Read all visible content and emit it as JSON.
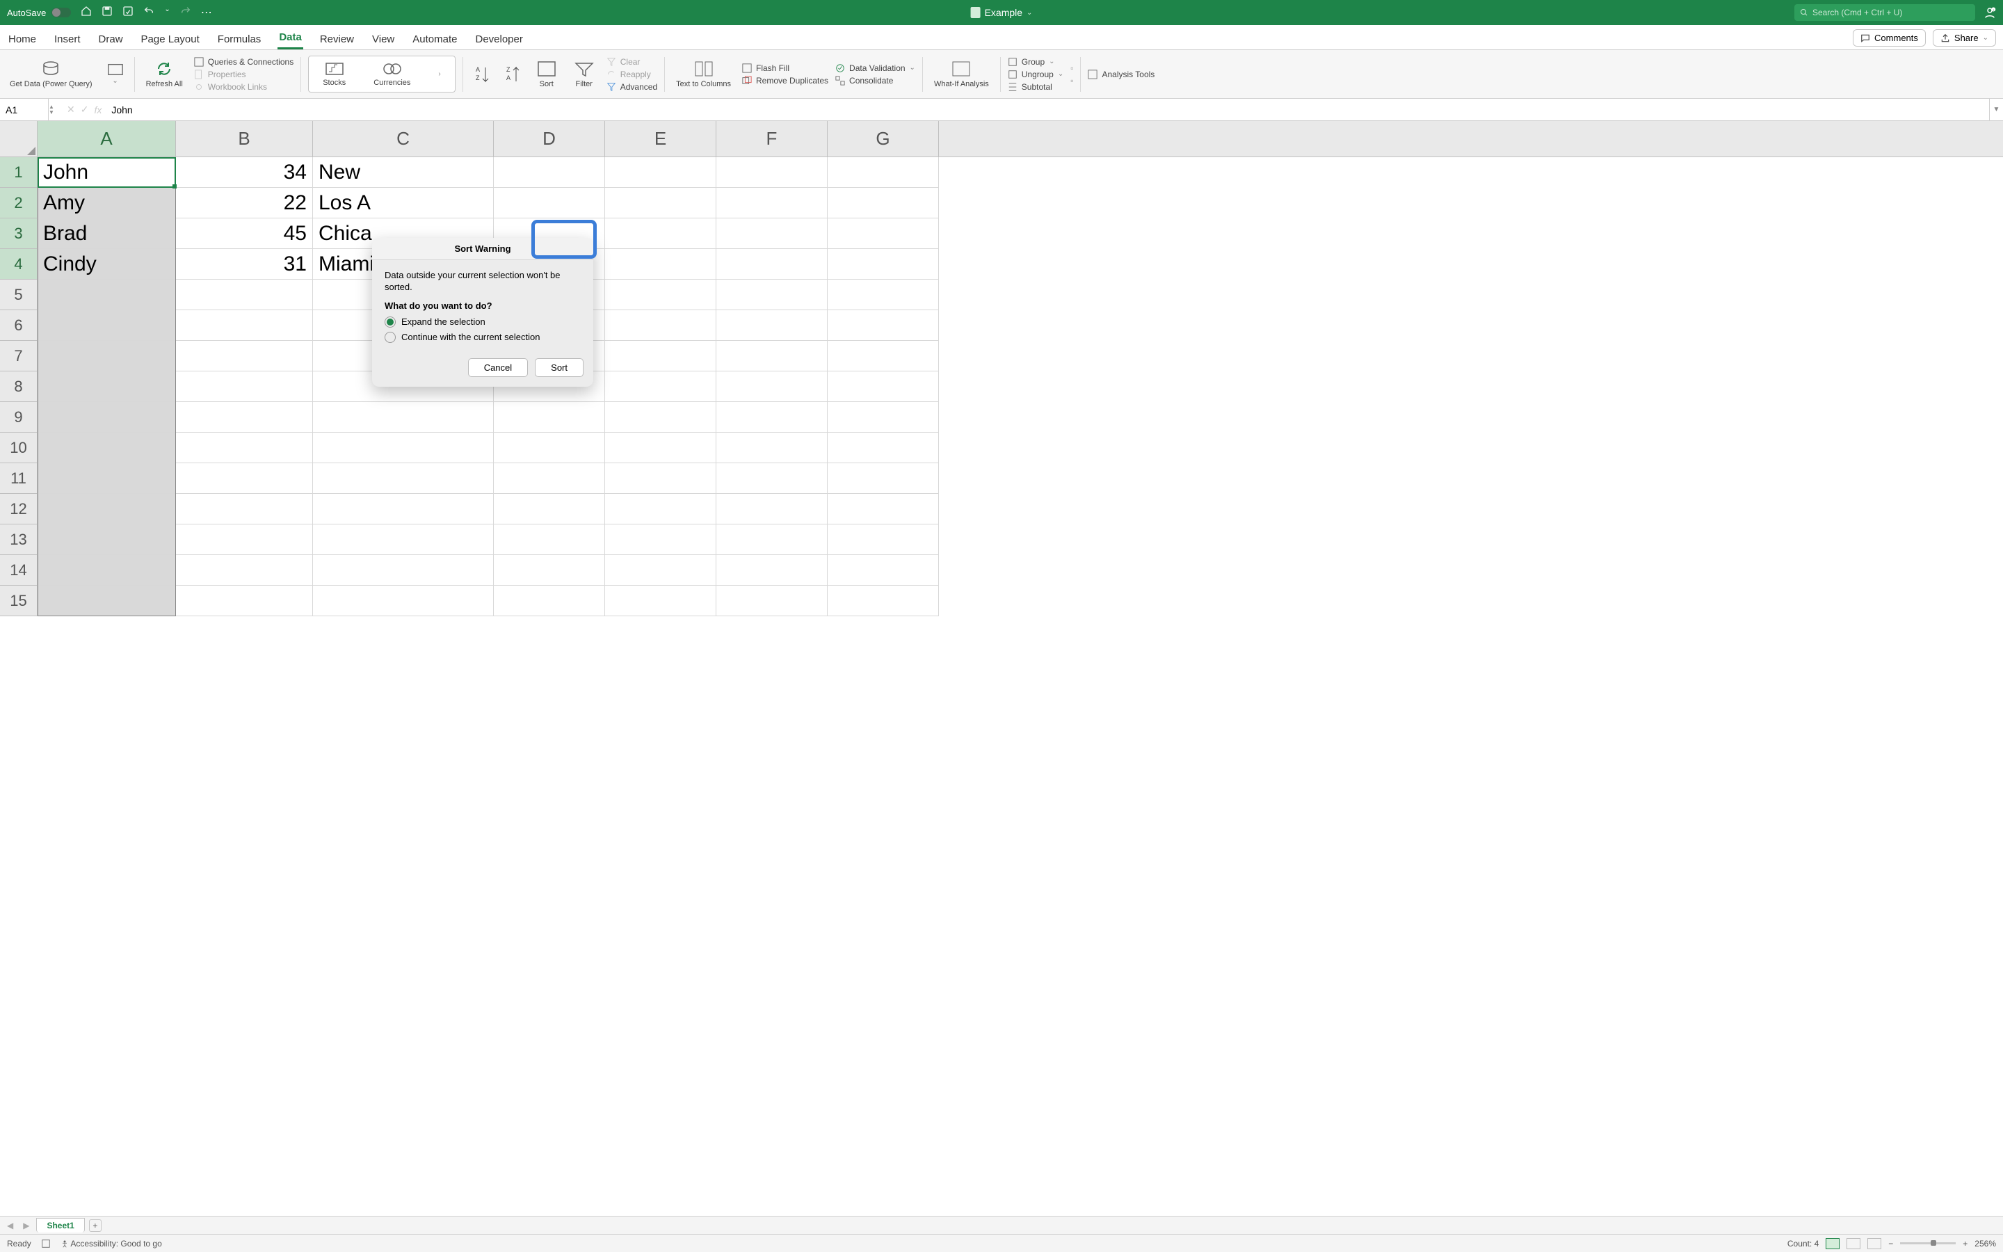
{
  "titlebar": {
    "autosave_label": "AutoSave",
    "doc_name": "Example",
    "search_placeholder": "Search (Cmd + Ctrl + U)"
  },
  "tabs": {
    "items": [
      "Home",
      "Insert",
      "Draw",
      "Page Layout",
      "Formulas",
      "Data",
      "Review",
      "View",
      "Automate",
      "Developer"
    ],
    "active_index": 5,
    "comments": "Comments",
    "share": "Share"
  },
  "ribbon": {
    "get_data": "Get Data (Power Query)",
    "refresh": "Refresh All",
    "queries": "Queries & Connections",
    "properties": "Properties",
    "workbook_links": "Workbook Links",
    "stocks": "Stocks",
    "currencies": "Currencies",
    "sort": "Sort",
    "filter": "Filter",
    "clear": "Clear",
    "reapply": "Reapply",
    "advanced": "Advanced",
    "text_to_columns": "Text to Columns",
    "flash_fill": "Flash Fill",
    "remove_duplicates": "Remove Duplicates",
    "data_validation": "Data Validation",
    "consolidate": "Consolidate",
    "what_if": "What-If Analysis",
    "group": "Group",
    "ungroup": "Ungroup",
    "subtotal": "Subtotal",
    "analysis_tools": "Analysis Tools"
  },
  "formula_bar": {
    "name_box": "A1",
    "formula": "John"
  },
  "columns": [
    "A",
    "B",
    "C",
    "D",
    "E",
    "F",
    "G"
  ],
  "selected_column": "A",
  "selected_rows": [
    1,
    2,
    3,
    4
  ],
  "cells": {
    "A1": "John",
    "B1": "34",
    "C1": "New",
    "A2": "Amy",
    "B2": "22",
    "C2": "Los A",
    "A3": "Brad",
    "B3": "45",
    "C3": "Chica",
    "A4": "Cindy",
    "B4": "31",
    "C4": "Miami"
  },
  "dialog": {
    "title": "Sort Warning",
    "message": "Data outside your current selection won't be sorted.",
    "question": "What do you want to do?",
    "option1": "Expand the selection",
    "option2": "Continue with the current selection",
    "cancel": "Cancel",
    "sort": "Sort",
    "selected_option": 1
  },
  "sheet_tabs": {
    "active": "Sheet1"
  },
  "status_bar": {
    "ready": "Ready",
    "accessibility": "Accessibility: Good to go",
    "count": "Count: 4",
    "zoom": "256%"
  }
}
